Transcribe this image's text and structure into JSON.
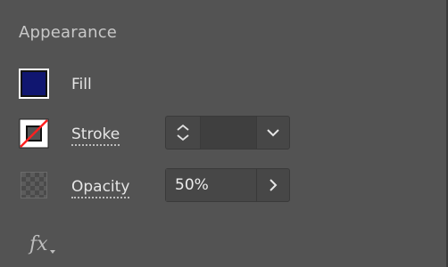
{
  "appearance": {
    "title": "Appearance",
    "fill": {
      "label": "Fill",
      "color": "#101670"
    },
    "stroke": {
      "label": "Stroke",
      "value": "",
      "indicator_color": "#ff2020"
    },
    "opacity": {
      "label": "Opacity",
      "value": "50%"
    },
    "effects_icon": "fx"
  }
}
